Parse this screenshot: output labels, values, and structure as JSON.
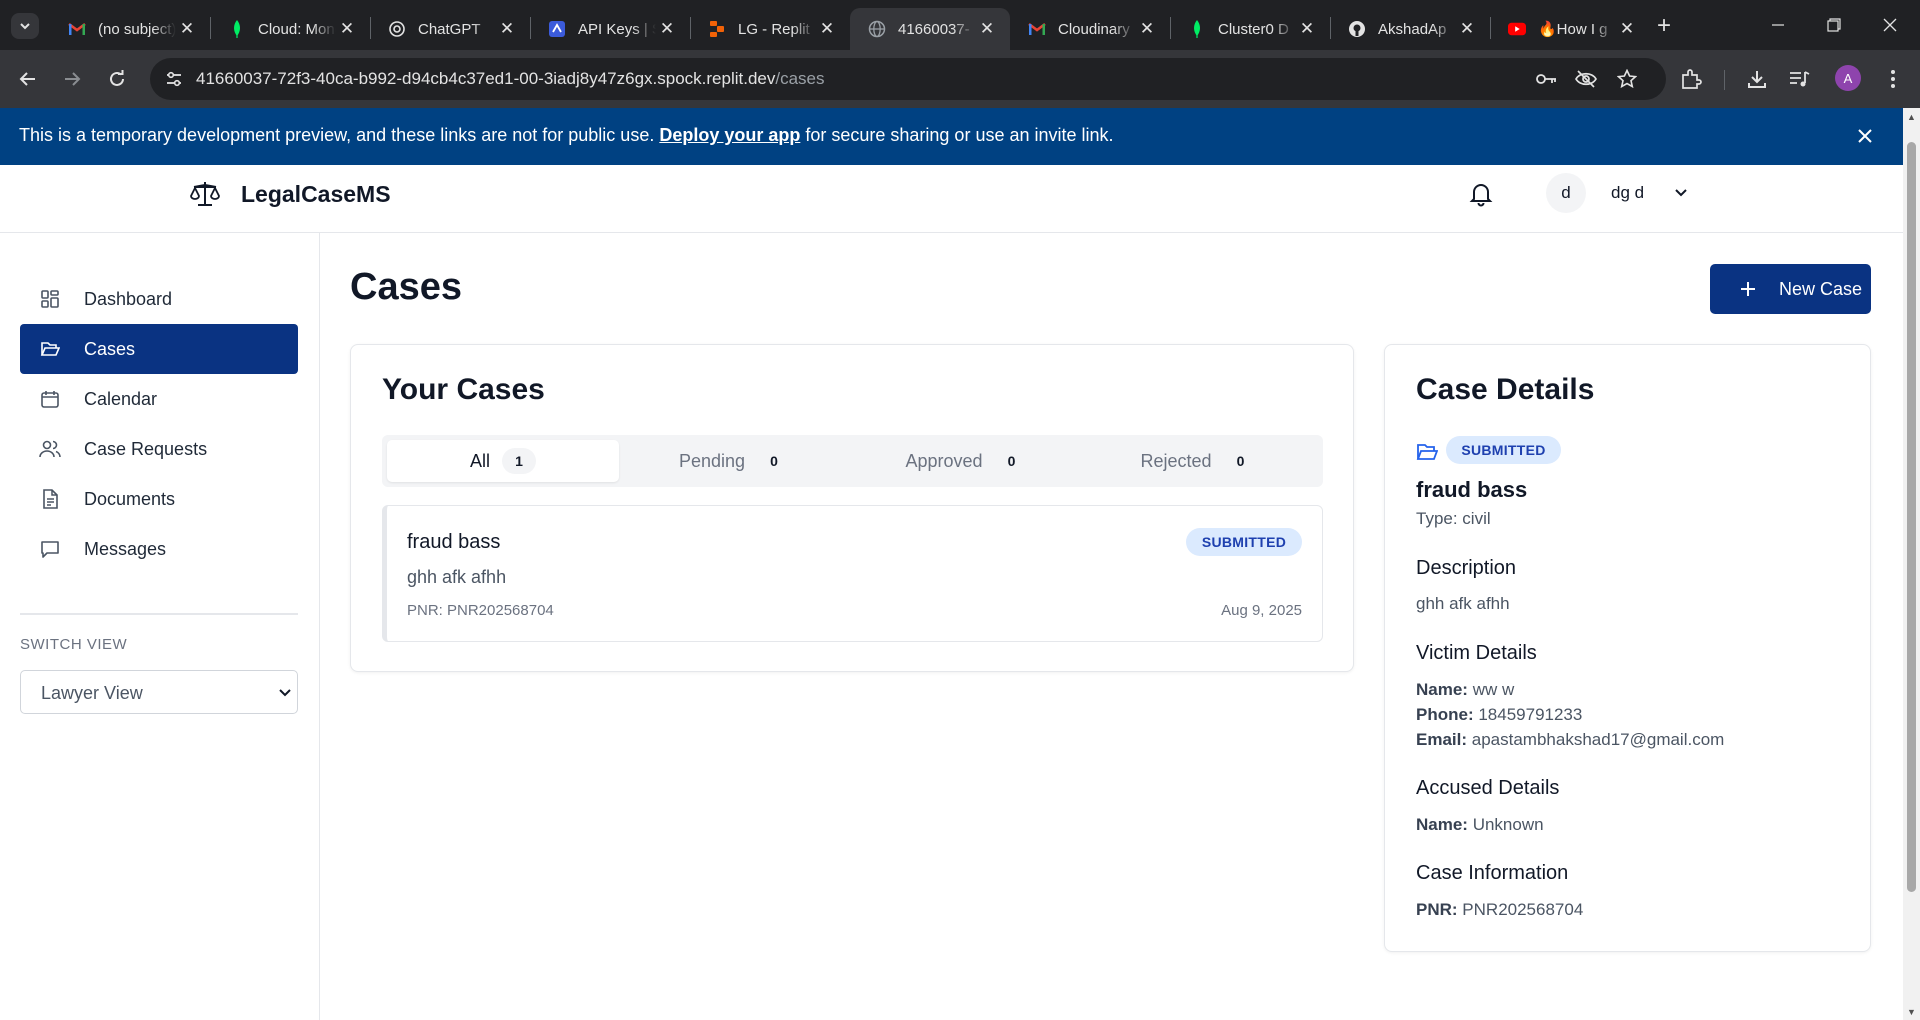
{
  "browser": {
    "tabs": [
      {
        "title": "(no subject)",
        "icon": "gmail-icon"
      },
      {
        "title": "Cloud: MongoDB",
        "icon": "mongodb-icon"
      },
      {
        "title": "ChatGPT",
        "icon": "chatgpt-icon"
      },
      {
        "title": "API Keys | S",
        "icon": "api-icon"
      },
      {
        "title": "LG - Replit",
        "icon": "replit-icon"
      },
      {
        "title": "41660037-",
        "icon": "globe-icon",
        "active": true
      },
      {
        "title": "Cloudinary",
        "icon": "gmail-icon"
      },
      {
        "title": "Cluster0 D",
        "icon": "mongodb-icon"
      },
      {
        "title": "AkshadAp",
        "icon": "github-icon"
      },
      {
        "title": "🔥How I g",
        "icon": "youtube-icon"
      }
    ],
    "url_host": "41660037-72f3-40ca-b992-d94cb4c37ed1-00-3iadj8y47z6gx.spock.replit.dev",
    "url_path": "/cases",
    "profile_initial": "A"
  },
  "banner": {
    "text_before": "This is a temporary development preview, and these links are not for public use. ",
    "link": "Deploy your app",
    "text_after": " for secure sharing or use an invite link."
  },
  "header": {
    "app_name": "LegalCaseMS",
    "avatar_initial": "d",
    "user_name": "dg d"
  },
  "sidebar": {
    "items": [
      {
        "label": "Dashboard",
        "icon": "dashboard-icon"
      },
      {
        "label": "Cases",
        "icon": "folder-icon",
        "active": true
      },
      {
        "label": "Calendar",
        "icon": "calendar-icon"
      },
      {
        "label": "Case Requests",
        "icon": "users-icon"
      },
      {
        "label": "Documents",
        "icon": "document-icon"
      },
      {
        "label": "Messages",
        "icon": "message-icon"
      }
    ],
    "switch_view_label": "SWITCH VIEW",
    "view_selected": "Lawyer View"
  },
  "main": {
    "title": "Cases",
    "new_case_label": "New Case",
    "cases_card": {
      "title": "Your Cases",
      "tabs": [
        {
          "label": "All",
          "count": "1",
          "active": true
        },
        {
          "label": "Pending",
          "count": "0"
        },
        {
          "label": "Approved",
          "count": "0"
        },
        {
          "label": "Rejected",
          "count": "0"
        }
      ],
      "cases": [
        {
          "title": "fraud bass",
          "description": "ghh afk afhh",
          "pnr": "PNR: PNR202568704",
          "date": "Aug 9, 2025",
          "status": "SUBMITTED"
        }
      ]
    },
    "details": {
      "heading": "Case Details",
      "status": "SUBMITTED",
      "title": "fraud bass",
      "type": "Type: civil",
      "description_heading": "Description",
      "description": "ghh afk afhh",
      "victim_heading": "Victim Details",
      "victim_name_label": "Name:",
      "victim_name": "ww w",
      "victim_phone_label": "Phone:",
      "victim_phone": "18459791233",
      "victim_email_label": "Email:",
      "victim_email": "apastambhakshad17@gmail.com",
      "accused_heading": "Accused Details",
      "accused_name_label": "Name:",
      "accused_name": "Unknown",
      "info_heading": "Case Information",
      "pnr_label": "PNR:",
      "pnr": "PNR202568704"
    }
  },
  "colors": {
    "primary": "#0a3382",
    "banner": "#004182",
    "badge_bg": "#dbeafe",
    "badge_text": "#1e40af"
  }
}
